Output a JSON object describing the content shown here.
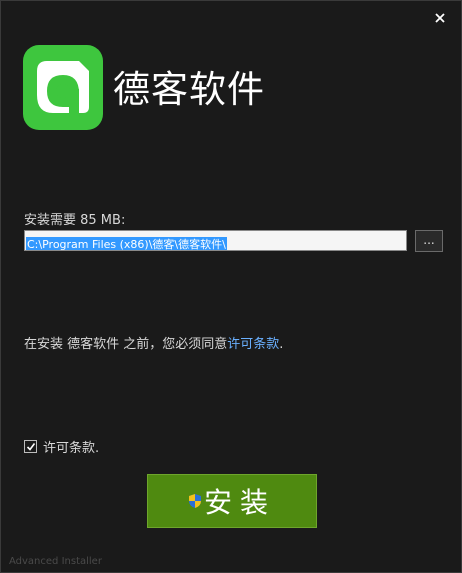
{
  "window": {
    "app_name": "德客软件",
    "close_icon": "close-icon"
  },
  "install": {
    "requirement": "安装需要 85 MB:",
    "path_value": "C:\\Program Files (x86)\\德客\\德客软件\\",
    "browse_label": "...",
    "license_prefix": "在安装 德客软件 之前，您必须同意",
    "license_link": "许可条款",
    "license_suffix": ".",
    "agree_label": "许可条款.",
    "agree_checked": true,
    "install_label": "安装"
  },
  "footer": {
    "text": "Advanced Installer"
  },
  "colors": {
    "background": "#1a1a1a",
    "logo_green": "#3ec63e",
    "install_button": "#4f8a10",
    "link": "#6ab0ff",
    "selection": "#3399ff"
  }
}
